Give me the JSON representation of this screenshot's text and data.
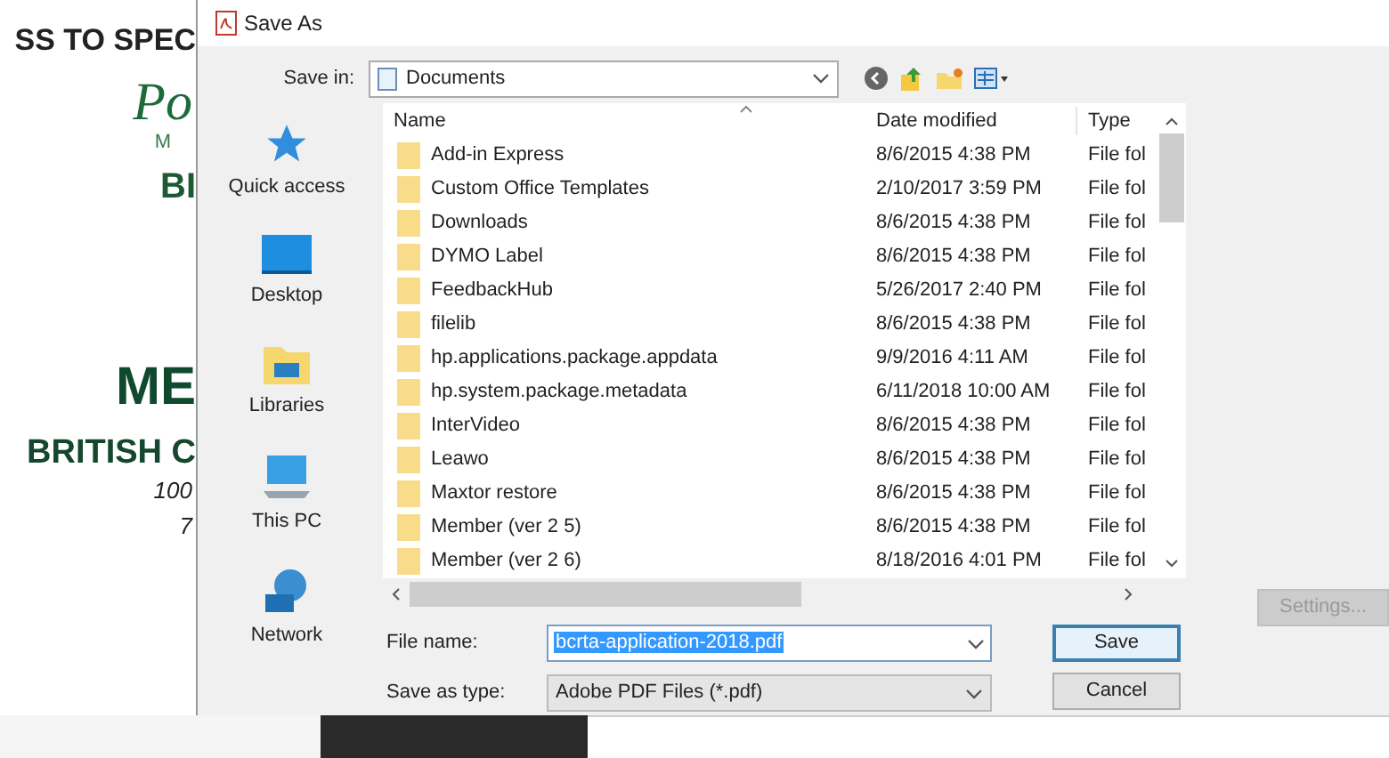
{
  "background_page": {
    "texts": [
      {
        "kind": "heading",
        "text": "SS TO SPEC"
      },
      {
        "kind": "script",
        "text": "Po"
      },
      {
        "kind": "small",
        "text": "M"
      },
      {
        "kind": "logo",
        "text": "BI"
      },
      {
        "kind": "big",
        "text": "ME"
      },
      {
        "kind": "subheading",
        "text": "BRITISH C"
      },
      {
        "kind": "italic",
        "text": "100"
      },
      {
        "kind": "italic",
        "text": "7"
      }
    ]
  },
  "dialog": {
    "title": "Save As",
    "save_in": {
      "label": "Save in:",
      "value": "Documents"
    },
    "nav": [
      {
        "kind": "star",
        "label": "Quick access"
      },
      {
        "kind": "desktop",
        "label": "Desktop"
      },
      {
        "kind": "libraries",
        "label": "Libraries"
      },
      {
        "kind": "pc",
        "label": "This PC"
      },
      {
        "kind": "network",
        "label": "Network"
      }
    ],
    "columns": [
      "Name",
      "Date modified",
      "Type"
    ],
    "rows": [
      {
        "name": "Add-in Express",
        "date": "8/6/2015 4:38 PM",
        "type": "File fol"
      },
      {
        "name": "Custom Office Templates",
        "date": "2/10/2017 3:59 PM",
        "type": "File fol"
      },
      {
        "name": "Downloads",
        "date": "8/6/2015 4:38 PM",
        "type": "File fol"
      },
      {
        "name": "DYMO Label",
        "date": "8/6/2015 4:38 PM",
        "type": "File fol"
      },
      {
        "name": "FeedbackHub",
        "date": "5/26/2017 2:40 PM",
        "type": "File fol"
      },
      {
        "name": "filelib",
        "date": "8/6/2015 4:38 PM",
        "type": "File fol"
      },
      {
        "name": "hp.applications.package.appdata",
        "date": "9/9/2016 4:11 AM",
        "type": "File fol"
      },
      {
        "name": "hp.system.package.metadata",
        "date": "6/11/2018 10:00 AM",
        "type": "File fol"
      },
      {
        "name": "InterVideo",
        "date": "8/6/2015 4:38 PM",
        "type": "File fol"
      },
      {
        "name": "Leawo",
        "date": "8/6/2015 4:38 PM",
        "type": "File fol"
      },
      {
        "name": "Maxtor restore",
        "date": "8/6/2015 4:38 PM",
        "type": "File fol"
      },
      {
        "name": "Member (ver 2 5)",
        "date": "8/6/2015 4:38 PM",
        "type": "File fol"
      },
      {
        "name": "Member (ver 2 6)",
        "date": "8/18/2016 4:01 PM",
        "type": "File fol"
      }
    ],
    "file_name": {
      "label": "File name:",
      "value": "bcrta-application-2018.pdf",
      "text_selected": true
    },
    "save_as_type": {
      "label": "Save as type:",
      "value": "Adobe PDF Files (*.pdf)"
    },
    "buttons": [
      {
        "label": "Save",
        "default": true
      },
      {
        "label": "Cancel",
        "default": false
      }
    ],
    "settings": {
      "label": "Settings...",
      "disabled": true
    }
  }
}
